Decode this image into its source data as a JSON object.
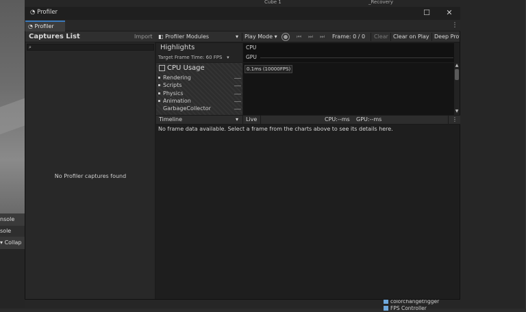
{
  "window": {
    "title": "Profiler",
    "tab_label": "Profiler"
  },
  "background": {
    "console_tab": "nsole",
    "console_tab2": "sole",
    "collapse_button": "Collap",
    "cube_label": "Cube 1",
    "recovery_label": "_Recovery",
    "hierarchy": [
      "colorchangetrigger",
      "FPS Controller"
    ]
  },
  "captures": {
    "title": "Captures List",
    "import_label": "Import",
    "search_value": "",
    "empty_message": "No Profiler captures found"
  },
  "toolbar": {
    "modules_label": "Profiler Modules",
    "play_mode_label": "Play Mode",
    "frame_label": "Frame: 0 / 0",
    "clear_label": "Clear",
    "clear_on_play_label": "Clear on Play",
    "deep_profile_label": "Deep Prof"
  },
  "highlights": {
    "title": "Highlights",
    "target_label": "Target Frame Time: 60 FPS",
    "cpu_label": "CPU",
    "gpu_label": "GPU"
  },
  "cpu_module": {
    "title": "CPU Usage",
    "items": [
      "Rendering",
      "Scripts",
      "Physics",
      "Animation",
      "GarbageCollector"
    ],
    "tooltip": "0.1ms (10000FPS)"
  },
  "details": {
    "view_label": "Timeline",
    "live_label": "Live",
    "cpu_stat": "CPU:--ms",
    "gpu_stat": "GPU:--ms",
    "no_data_message": "No frame data available. Select a frame from the charts above to see its details here."
  },
  "icons": {
    "window_icon": "profiler-icon",
    "record_icon": "record-icon",
    "kebab_icon": "kebab-menu-icon"
  },
  "colors": {
    "tab_accent": "#3a79bb",
    "window_bg": "#1e1e1e"
  }
}
